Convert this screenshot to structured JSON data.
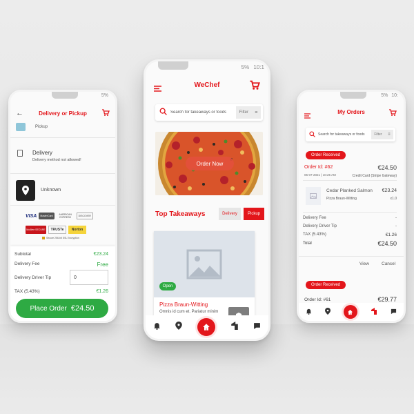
{
  "colors": {
    "accent": "#e3161b",
    "green": "#2eaa43",
    "background": "#e9e9e9"
  },
  "left_phone": {
    "status": "5%",
    "title": "Delivery or Pickup",
    "pickup_label": "Pickup",
    "delivery_title": "Delivery",
    "delivery_note": "Delivery method not allowed!",
    "location_label": "Unknown",
    "payment_logos": [
      "VISA",
      "MasterCard",
      "AMERICAN EXPRESS",
      "DISCOVER"
    ],
    "trust_badges": [
      "McAfee SECURE",
      "TRUSTe",
      "Norton"
    ],
    "secure_note": "Secure 256-bit SSL Encryption",
    "subtotal_label": "Subtotal",
    "subtotal_value": "€23.24",
    "delivery_fee_label": "Delivery Fee",
    "delivery_fee_value": "Free",
    "tip_label": "Delivery Driver Tip",
    "tip_value": "0",
    "tax_label": "TAX (5.43%)",
    "tax_value": "€1.26",
    "place_order_label": "Place Order",
    "place_order_total": "€24.50"
  },
  "center_phone": {
    "status": "5%",
    "time": "10:1",
    "brand": "WeChef",
    "search_placeholder": "Search for takeaways or foods",
    "filter_label": "Filter",
    "order_now_label": "Order Now",
    "section_title": "Top Takeaways",
    "tabs": [
      {
        "label": "Delivery"
      },
      {
        "label": "Pickup"
      }
    ],
    "card_status": "Open",
    "card_title": "Pizza Braun-Witting",
    "card_subtitle": "Omnis id cum et. Pariatur minim"
  },
  "right_phone": {
    "status": "5%",
    "time": "10:",
    "title": "My Orders",
    "search_placeholder": "Search for takeaways or foods",
    "filter_label": "Filter",
    "badge_received": "Order Received",
    "order1": {
      "id": "Order Id: #62",
      "amount": "€24.50",
      "date": "05-07-2021 | 10:25 AM",
      "payment": "Credit Card (Stripe Gateway)",
      "item_name": "Cedar Planked Salmon",
      "item_price": "€23.24",
      "item_restaurant": "Pizza Braun-Witting",
      "item_qty": "x1.0"
    },
    "delivery_fee_label": "Delivery Fee",
    "delivery_fee_value": "-",
    "tip_label": "Delivery Driver Tip",
    "tip_value": "-",
    "tax_label": "TAX (5.43%)",
    "tax_value": "€1.26",
    "total_label": "Total",
    "total_value": "€24.50",
    "view_label": "View",
    "cancel_label": "Cancel",
    "badge_received_2": "Order Received",
    "order2": {
      "id": "Order Id: #61",
      "amount": "€29.77"
    }
  },
  "nav_icons": [
    "bell-icon",
    "pin-icon",
    "home-icon",
    "fastfood-icon",
    "chat-icon"
  ]
}
